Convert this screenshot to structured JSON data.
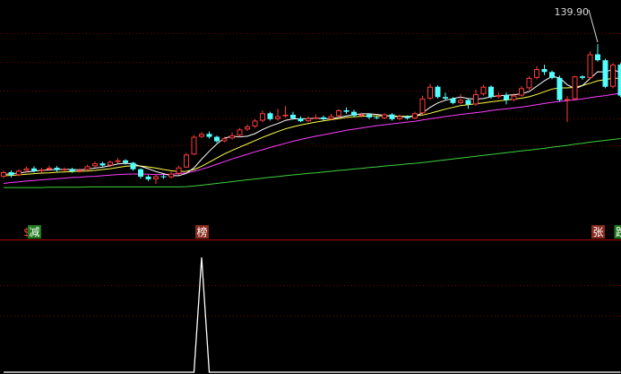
{
  "chart_data": [
    {
      "type": "candlestick",
      "title": "",
      "price_high_label": "139.90",
      "grid": true,
      "colors": {
        "up": "#ff3b3b",
        "down": "#54ffff",
        "ma_short": "#ffffff",
        "ma_mid": "#ffff4a",
        "ma_long": "#ff3cff",
        "ma_slow": "#3bd23b",
        "grid": "#7a0000",
        "separator": "#b00000"
      },
      "ylim": [
        75,
        145
      ],
      "candles": [
        [
          87.5,
          89.0,
          87.0,
          89.5
        ],
        [
          89.0,
          88.0,
          87.2,
          89.6
        ],
        [
          88.0,
          89.5,
          87.6,
          90.0
        ],
        [
          89.5,
          90.3,
          88.8,
          90.9
        ],
        [
          90.3,
          89.4,
          88.9,
          91.0
        ],
        [
          89.4,
          89.9,
          88.9,
          90.5
        ],
        [
          89.9,
          90.5,
          89.4,
          91.2
        ],
        [
          90.5,
          89.7,
          89.2,
          91.1
        ],
        [
          89.7,
          90.1,
          89.3,
          90.6
        ],
        [
          90.1,
          89.3,
          88.8,
          90.5
        ],
        [
          89.3,
          89.8,
          88.9,
          90.3
        ],
        [
          89.8,
          91.0,
          89.4,
          91.5
        ],
        [
          91.0,
          92.0,
          90.6,
          92.6
        ],
        [
          92.0,
          91.3,
          90.9,
          92.5
        ],
        [
          91.3,
          92.5,
          90.8,
          93.0
        ],
        [
          92.5,
          93.0,
          92.0,
          93.8
        ],
        [
          93.0,
          92.2,
          91.6,
          93.4
        ],
        [
          92.2,
          90.0,
          89.5,
          92.5
        ],
        [
          90.0,
          87.5,
          86.8,
          90.3
        ],
        [
          87.5,
          86.6,
          86.0,
          88.0
        ],
        [
          86.6,
          87.6,
          85.0,
          88.2
        ],
        [
          87.6,
          87.3,
          86.8,
          88.2
        ],
        [
          87.3,
          88.5,
          86.9,
          89.2
        ],
        [
          88.5,
          90.6,
          88.1,
          91.2
        ],
        [
          90.6,
          95.0,
          90.4,
          95.6
        ],
        [
          95.0,
          101.0,
          94.8,
          101.6
        ],
        [
          101.0,
          102.0,
          100.6,
          102.6
        ],
        [
          102.0,
          101.0,
          100.4,
          102.8
        ],
        [
          101.0,
          99.5,
          99.0,
          101.4
        ],
        [
          99.5,
          100.5,
          99.2,
          101.0
        ],
        [
          100.5,
          101.5,
          100.0,
          102.5
        ],
        [
          101.5,
          103.5,
          101.0,
          104.0
        ],
        [
          103.5,
          104.5,
          103.0,
          105.2
        ],
        [
          104.5,
          106.5,
          104.0,
          107.0
        ],
        [
          106.5,
          109.0,
          106.0,
          110.0
        ],
        [
          109.0,
          107.0,
          106.5,
          109.5
        ],
        [
          107.0,
          108.0,
          106.5,
          110.5
        ],
        [
          108.0,
          108.5,
          107.5,
          111.5
        ],
        [
          108.5,
          107.3,
          106.8,
          109.5
        ],
        [
          107.3,
          106.3,
          106.0,
          108.0
        ],
        [
          106.3,
          107.3,
          106.0,
          108.0
        ],
        [
          107.3,
          107.6,
          107.0,
          108.6
        ],
        [
          107.6,
          107.0,
          106.5,
          108.2
        ],
        [
          107.0,
          108.0,
          106.7,
          108.8
        ],
        [
          108.0,
          110.0,
          107.5,
          110.5
        ],
        [
          110.0,
          109.5,
          108.8,
          111.0
        ],
        [
          109.5,
          108.2,
          107.6,
          110.2
        ],
        [
          108.2,
          108.6,
          107.6,
          109.2
        ],
        [
          108.6,
          107.6,
          107.0,
          109.0
        ],
        [
          107.6,
          107.3,
          107.0,
          108.0
        ],
        [
          107.3,
          108.6,
          107.0,
          109.0
        ],
        [
          108.6,
          107.0,
          106.5,
          109.0
        ],
        [
          107.0,
          108.0,
          106.6,
          108.6
        ],
        [
          108.0,
          107.3,
          106.8,
          108.3
        ],
        [
          107.3,
          109.0,
          107.0,
          109.5
        ],
        [
          109.0,
          114.0,
          108.6,
          115.0
        ],
        [
          114.0,
          118.0,
          113.5,
          119.0
        ],
        [
          118.0,
          114.5,
          114.0,
          118.5
        ],
        [
          114.5,
          114.0,
          113.5,
          116.0
        ],
        [
          114.0,
          112.5,
          112.0,
          114.5
        ],
        [
          112.5,
          113.5,
          112.0,
          115.5
        ],
        [
          113.5,
          112.0,
          110.5,
          114.0
        ],
        [
          112.0,
          115.5,
          111.5,
          117.0
        ],
        [
          115.5,
          118.0,
          115.0,
          118.6
        ],
        [
          118.0,
          114.5,
          114.0,
          118.5
        ],
        [
          114.5,
          115.2,
          114.0,
          116.0
        ],
        [
          115.2,
          113.5,
          112.0,
          116.0
        ],
        [
          113.5,
          115.0,
          113.0,
          115.8
        ],
        [
          115.0,
          117.5,
          114.6,
          118.2
        ],
        [
          117.5,
          121.0,
          117.0,
          121.6
        ],
        [
          121.0,
          124.0,
          120.5,
          125.0
        ],
        [
          124.0,
          123.0,
          122.0,
          125.5
        ],
        [
          123.0,
          121.0,
          120.5,
          123.5
        ],
        [
          121.0,
          113.5,
          113.0,
          121.8
        ],
        [
          113.5,
          113.8,
          106.0,
          114.8
        ],
        [
          113.8,
          121.5,
          113.3,
          121.7
        ],
        [
          121.5,
          121.0,
          120.4,
          121.9
        ],
        [
          121.0,
          129.0,
          120.7,
          130.0
        ],
        [
          129.0,
          127.0,
          126.5,
          132.5
        ],
        [
          127.0,
          118.0,
          117.5,
          127.5
        ],
        [
          118.0,
          125.5,
          117.5,
          126.0
        ],
        [
          125.5,
          115.0,
          114.5,
          126.0
        ]
      ],
      "ma_short": [
        88.2,
        88.5,
        88.7,
        89.1,
        89.4,
        89.6,
        89.8,
        89.9,
        90.0,
        89.9,
        89.8,
        90.0,
        90.4,
        90.7,
        91.2,
        91.8,
        92.0,
        91.8,
        91.0,
        90.2,
        89.2,
        88.5,
        87.8,
        87.8,
        88.6,
        90.5,
        93.4,
        96.1,
        98.6,
        100.6,
        101.2,
        101.0,
        101.2,
        102.1,
        103.5,
        104.6,
        105.5,
        106.6,
        107.1,
        107.1,
        107.2,
        107.3,
        107.2,
        107.2,
        107.6,
        108.1,
        108.5,
        108.8,
        108.8,
        108.6,
        108.3,
        108.0,
        107.8,
        107.8,
        108.0,
        109.1,
        111.0,
        112.5,
        113.4,
        114.0,
        114.5,
        114.0,
        113.8,
        114.0,
        114.6,
        115.0,
        115.1,
        115.3,
        115.6,
        116.4,
        118.2,
        120.0,
        121.5,
        121.0,
        118.7,
        117.3,
        118.4,
        120.8,
        123.1,
        123.0,
        123.9,
        122.7
      ],
      "ma_mid": [
        87.8,
        87.9,
        88.1,
        88.3,
        88.5,
        88.7,
        88.8,
        89.0,
        89.1,
        89.2,
        89.3,
        89.4,
        89.6,
        89.9,
        90.2,
        90.6,
        91.0,
        91.2,
        91.1,
        90.8,
        90.4,
        89.9,
        89.5,
        89.2,
        89.3,
        89.9,
        91.0,
        92.4,
        93.8,
        95.2,
        96.4,
        97.5,
        98.6,
        99.7,
        100.8,
        101.8,
        102.8,
        103.7,
        104.4,
        105.0,
        105.5,
        106.0,
        106.4,
        106.8,
        107.2,
        107.6,
        107.8,
        108.0,
        108.1,
        108.1,
        108.1,
        108.1,
        108.0,
        108.0,
        108.1,
        108.4,
        109.0,
        109.7,
        110.4,
        111.0,
        111.6,
        111.9,
        112.2,
        112.5,
        112.9,
        113.2,
        113.5,
        113.8,
        114.1,
        114.6,
        115.4,
        116.3,
        117.2,
        117.6,
        117.6,
        117.8,
        118.4,
        119.2,
        120.0,
        120.4,
        120.9,
        120.9
      ],
      "ma_long": [
        85.2,
        85.5,
        85.7,
        86.0,
        86.2,
        86.4,
        86.6,
        86.8,
        87.0,
        87.2,
        87.3,
        87.5,
        87.6,
        87.8,
        88.0,
        88.2,
        88.3,
        88.4,
        88.4,
        88.3,
        88.2,
        88.2,
        88.3,
        88.5,
        88.8,
        89.3,
        90.0,
        90.8,
        91.7,
        92.6,
        93.5,
        94.3,
        95.1,
        95.9,
        96.6,
        97.4,
        98.1,
        98.8,
        99.5,
        100.1,
        100.7,
        101.2,
        101.7,
        102.2,
        102.7,
        103.2,
        103.6,
        104.0,
        104.4,
        104.8,
        105.1,
        105.4,
        105.7,
        106.0,
        106.3,
        106.7,
        107.1,
        107.5,
        107.9,
        108.2,
        108.6,
        108.9,
        109.2,
        109.5,
        109.9,
        110.2,
        110.5,
        110.8,
        111.1,
        111.5,
        111.9,
        112.3,
        112.7,
        113.0,
        113.3,
        113.6,
        113.9,
        114.3,
        114.7,
        115.0,
        115.4,
        115.8
      ],
      "ma_slow": [
        83.8,
        83.8,
        83.8,
        83.8,
        83.8,
        83.8,
        83.9,
        83.9,
        83.9,
        83.9,
        83.9,
        84.0,
        84.0,
        84.0,
        84.0,
        84.0,
        84.0,
        84.0,
        84.0,
        84.0,
        84.0,
        84.0,
        84.0,
        84.0,
        84.1,
        84.3,
        84.6,
        84.9,
        85.2,
        85.5,
        85.8,
        86.1,
        86.4,
        86.7,
        87.0,
        87.3,
        87.5,
        87.8,
        88.1,
        88.3,
        88.6,
        88.8,
        89.1,
        89.3,
        89.6,
        89.8,
        90.1,
        90.3,
        90.6,
        90.8,
        91.1,
        91.3,
        91.5,
        91.8,
        92.0,
        92.3,
        92.6,
        92.9,
        93.2,
        93.5,
        93.8,
        94.1,
        94.4,
        94.7,
        95.0,
        95.3,
        95.6,
        95.9,
        96.2,
        96.5,
        96.8,
        97.1,
        97.5,
        97.8,
        98.1,
        98.5,
        98.8,
        99.2,
        99.5,
        99.8,
        100.1,
        100.4
      ],
      "markers": [
        {
          "index": 3,
          "text": "$",
          "color": "#ff3b3b",
          "bg": "#000000"
        },
        {
          "index": 4,
          "text": "减",
          "color": "#ffffff",
          "bg": "#1f7a1f"
        },
        {
          "index": 26,
          "text": "榜",
          "color": "#ffffff",
          "bg": "#8a2a1e"
        },
        {
          "index": 78,
          "text": "张",
          "color": "#ffffff",
          "bg": "#8a2a1e"
        },
        {
          "index": 81,
          "text": "跌",
          "color": "#ffffff",
          "bg": "#1f7a1f"
        }
      ]
    },
    {
      "type": "line",
      "title": "",
      "ylim": [
        0,
        1
      ],
      "color": "#ffffff",
      "values": [
        0,
        0,
        0,
        0,
        0,
        0,
        0,
        0,
        0,
        0,
        0,
        0,
        0,
        0,
        0,
        0,
        0,
        0,
        0,
        0,
        0,
        0,
        0,
        0,
        0,
        0,
        1,
        0,
        0,
        0,
        0,
        0,
        0,
        0,
        0,
        0,
        0,
        0,
        0,
        0,
        0,
        0,
        0,
        0,
        0,
        0,
        0,
        0,
        0,
        0,
        0,
        0,
        0,
        0,
        0,
        0,
        0,
        0,
        0,
        0,
        0,
        0,
        0,
        0,
        0,
        0,
        0,
        0,
        0,
        0,
        0,
        0,
        0,
        0,
        0,
        0,
        0,
        0,
        0,
        0,
        0,
        0
      ]
    }
  ]
}
